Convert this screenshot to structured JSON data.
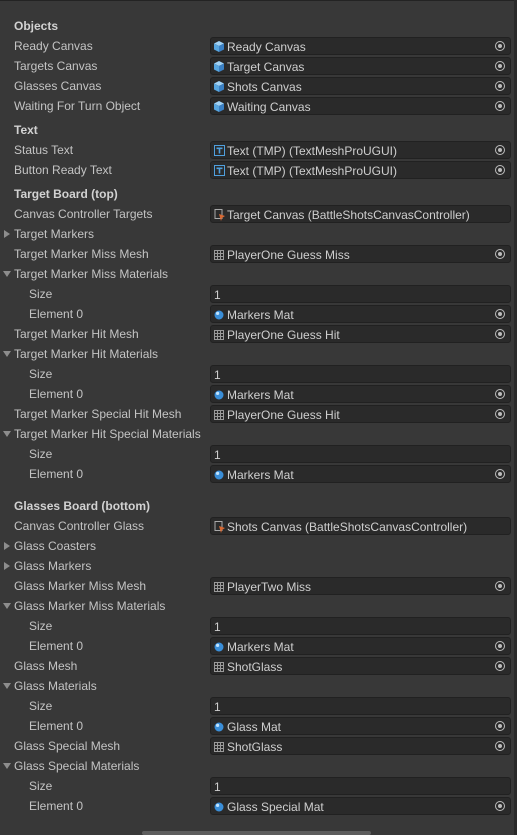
{
  "sections": [
    {
      "type": "header",
      "label": "Objects"
    },
    {
      "type": "field",
      "label": "Ready Canvas",
      "icon": "gameobject-icon",
      "value": "Ready Canvas",
      "picker": true
    },
    {
      "type": "field",
      "label": "Targets Canvas",
      "icon": "gameobject-icon",
      "value": "Target Canvas",
      "picker": true
    },
    {
      "type": "field",
      "label": "Glasses Canvas",
      "icon": "gameobject-icon",
      "value": "Shots Canvas",
      "picker": true
    },
    {
      "type": "field",
      "label": "Waiting For Turn Object",
      "icon": "gameobject-icon",
      "value": "Waiting Canvas",
      "picker": true
    },
    {
      "type": "header",
      "label": "Text"
    },
    {
      "type": "field",
      "label": "Status Text",
      "icon": "textmeshpro-icon",
      "value": "Text (TMP) (TextMeshProUGUI)",
      "picker": true
    },
    {
      "type": "field",
      "label": "Button Ready Text",
      "icon": "textmeshpro-icon",
      "value": "Text (TMP) (TextMeshProUGUI)",
      "picker": true
    },
    {
      "type": "header",
      "label": "Target Board (top)"
    },
    {
      "type": "field",
      "label": "Canvas Controller Targets",
      "icon": "script-icon",
      "value": "Target Canvas (BattleShotsCanvasController)",
      "picker": false
    },
    {
      "type": "foldout",
      "label": "Target Markers",
      "open": false
    },
    {
      "type": "field",
      "label": "Target Marker Miss Mesh",
      "icon": "mesh-icon",
      "value": "PlayerOne Guess Miss",
      "picker": true
    },
    {
      "type": "foldout",
      "label": "Target Marker Miss Materials",
      "open": true
    },
    {
      "type": "num",
      "label": "Size",
      "value": "1"
    },
    {
      "type": "subfield",
      "label": "Element 0",
      "icon": "material-icon",
      "value": "Markers Mat",
      "picker": true
    },
    {
      "type": "field",
      "label": "Target Marker Hit Mesh",
      "icon": "mesh-icon",
      "value": "PlayerOne Guess Hit",
      "picker": true
    },
    {
      "type": "foldout",
      "label": "Target Marker Hit Materials",
      "open": true
    },
    {
      "type": "num",
      "label": "Size",
      "value": "1"
    },
    {
      "type": "subfield",
      "label": "Element 0",
      "icon": "material-icon",
      "value": "Markers Mat",
      "picker": true
    },
    {
      "type": "field",
      "label": "Target Marker Special Hit Mesh",
      "icon": "mesh-icon",
      "value": "PlayerOne Guess Hit",
      "picker": true
    },
    {
      "type": "foldout",
      "label": "Target Marker Hit Special Materials",
      "open": true
    },
    {
      "type": "num",
      "label": "Size",
      "value": "1"
    },
    {
      "type": "subfield",
      "label": "Element 0",
      "icon": "material-icon",
      "value": "Markers Mat",
      "picker": true
    },
    {
      "type": "spacer"
    },
    {
      "type": "header",
      "label": "Glasses Board (bottom)"
    },
    {
      "type": "field",
      "label": "Canvas Controller Glass",
      "icon": "script-icon",
      "value": "Shots Canvas (BattleShotsCanvasController)",
      "picker": false
    },
    {
      "type": "foldout",
      "label": "Glass Coasters",
      "open": false
    },
    {
      "type": "foldout",
      "label": "Glass Markers",
      "open": false
    },
    {
      "type": "field",
      "label": "Glass Marker Miss Mesh",
      "icon": "mesh-icon",
      "value": "PlayerTwo Miss",
      "picker": true
    },
    {
      "type": "foldout",
      "label": "Glass Marker Miss Materials",
      "open": true
    },
    {
      "type": "num",
      "label": "Size",
      "value": "1"
    },
    {
      "type": "subfield",
      "label": "Element 0",
      "icon": "material-icon",
      "value": "Markers Mat",
      "picker": true
    },
    {
      "type": "field",
      "label": "Glass Mesh",
      "icon": "mesh-icon",
      "value": "ShotGlass",
      "picker": true
    },
    {
      "type": "foldout",
      "label": "Glass Materials",
      "open": true
    },
    {
      "type": "num",
      "label": "Size",
      "value": "1"
    },
    {
      "type": "subfield",
      "label": "Element 0",
      "icon": "material-icon",
      "value": "Glass Mat",
      "picker": true
    },
    {
      "type": "field",
      "label": "Glass Special Mesh",
      "icon": "mesh-icon",
      "value": "ShotGlass",
      "picker": true
    },
    {
      "type": "foldout",
      "label": "Glass Special Materials",
      "open": true
    },
    {
      "type": "num",
      "label": "Size",
      "value": "1"
    },
    {
      "type": "subfield",
      "label": "Element 0",
      "icon": "material-icon",
      "value": "Glass Special Mat",
      "picker": true
    }
  ],
  "colors": {
    "background": "#383838",
    "field_background": "#2a2a2a",
    "gameobject_icon": "#58a6df",
    "tmp_icon": "#4f9fdc",
    "material_icon": "#3a8ed8",
    "script_icon": "#d86a34"
  }
}
